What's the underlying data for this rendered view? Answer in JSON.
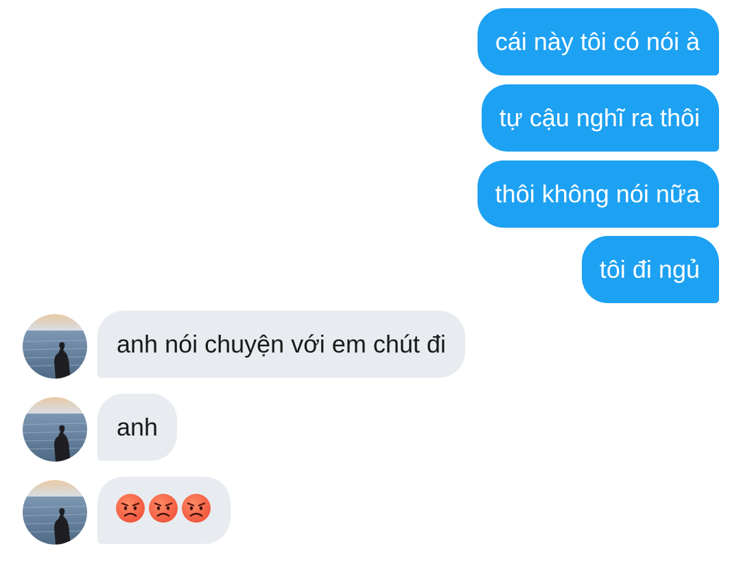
{
  "messages": {
    "outgoing": [
      "cái này tôi có nói à",
      "tự cậu nghĩ ra thôi",
      "thôi không nói nữa",
      "tôi đi ngủ"
    ],
    "incoming": [
      "anh nói chuyện với em chút đi",
      "anh"
    ],
    "incoming_emoji": [
      "angry-face",
      "angry-face",
      "angry-face"
    ]
  },
  "colors": {
    "outgoing_bubble": "#1da1f2",
    "incoming_bubble": "#e8ecf0",
    "emoji_face": "#f0533a"
  },
  "avatar": {
    "icon": "avatar-person-at-sea"
  }
}
